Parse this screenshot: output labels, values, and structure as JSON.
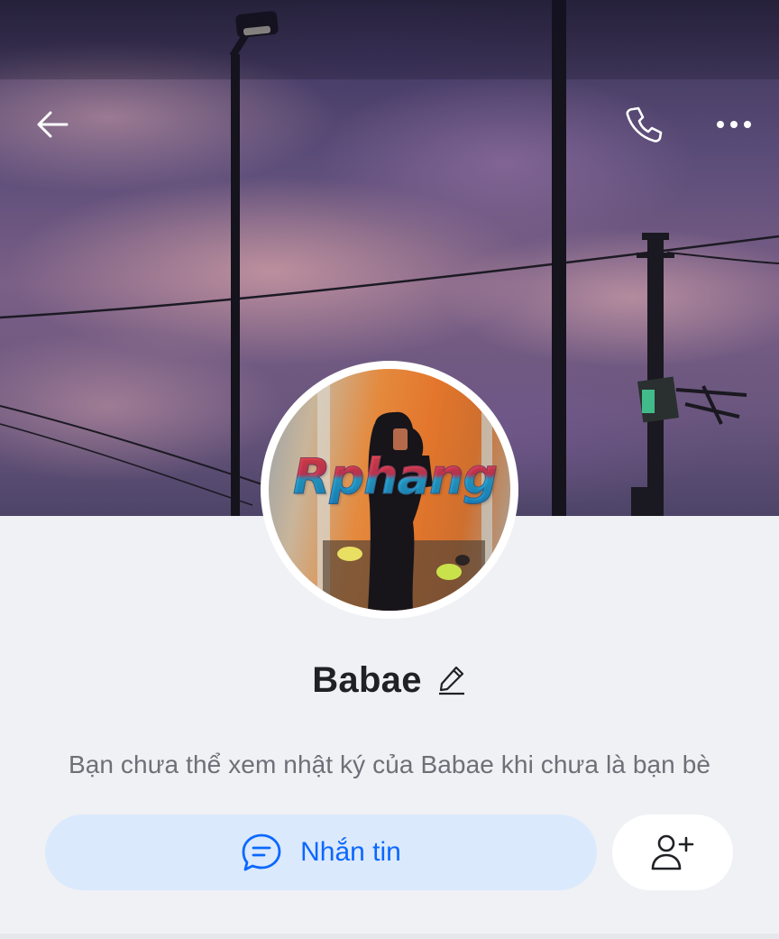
{
  "header": {
    "back_icon": "arrow-left-icon",
    "call_icon": "phone-icon",
    "more_icon": "more-horizontal-icon"
  },
  "cover": {
    "description_icon": "cover-photo"
  },
  "profile": {
    "name": "Babae",
    "edit_icon": "pencil-icon",
    "avatar_watermark": "Rphang"
  },
  "notice": {
    "text": "Bạn chưa thể xem nhật ký của Babae khi chưa là bạn bè"
  },
  "actions": {
    "message_label": "Nhắn tin",
    "message_icon": "chat-bubble-icon",
    "add_friend_icon": "add-user-icon"
  },
  "colors": {
    "accent": "#0a68ff",
    "message_button_bg": "#dbe9fc",
    "background": "#f0f1f5",
    "name_text": "#1f2125",
    "notice_text": "#6c7077"
  }
}
